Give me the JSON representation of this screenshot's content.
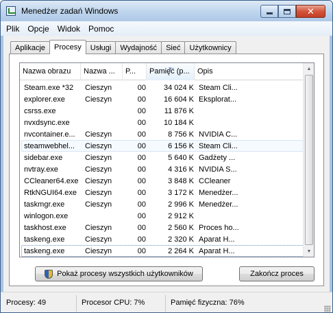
{
  "window": {
    "title": "Menedżer zadań Windows",
    "close_symbol": "✕"
  },
  "menu": [
    "Plik",
    "Opcje",
    "Widok",
    "Pomoc"
  ],
  "tabs": [
    "Aplikacje",
    "Procesy",
    "Usługi",
    "Wydajność",
    "Sieć",
    "Użytkownicy"
  ],
  "active_tab": "Procesy",
  "table": {
    "columns": [
      "Nazwa obrazu",
      "Nazwa ...",
      "P...",
      "Pamięć (p...",
      "Opis"
    ],
    "sorted_column": "Pamięć (p...",
    "rows": [
      [
        "Steam.exe *32",
        "Cieszyn",
        "00",
        "34 024 K",
        "Steam Cli..."
      ],
      [
        "explorer.exe",
        "Cieszyn",
        "00",
        "16 604 K",
        "Eksplorat..."
      ],
      [
        "csrss.exe",
        "",
        "00",
        "11 876 K",
        ""
      ],
      [
        "nvxdsync.exe",
        "",
        "00",
        "10 184 K",
        ""
      ],
      [
        "nvcontainer.e...",
        "Cieszyn",
        "00",
        "8 756 K",
        "NVIDIA C..."
      ],
      [
        "steamwebhel...",
        "Cieszyn",
        "00",
        "6 156 K",
        "Steam Cli..."
      ],
      [
        "sidebar.exe",
        "Cieszyn",
        "00",
        "5 640 K",
        "Gadżety ..."
      ],
      [
        "nvtray.exe",
        "Cieszyn",
        "00",
        "4 316 K",
        "NVIDIA S..."
      ],
      [
        "CCleaner64.exe",
        "Cieszyn",
        "00",
        "3 848 K",
        "CCleaner"
      ],
      [
        "RtkNGUI64.exe",
        "Cieszyn",
        "00",
        "3 172 K",
        "Menedżer..."
      ],
      [
        "taskmgr.exe",
        "Cieszyn",
        "00",
        "2 996 K",
        "Menedżer..."
      ],
      [
        "winlogon.exe",
        "",
        "00",
        "2 912 K",
        ""
      ],
      [
        "taskhost.exe",
        "Cieszyn",
        "00",
        "2 560 K",
        "Proces ho..."
      ],
      [
        "taskeng.exe",
        "Cieszyn",
        "00",
        "2 320 K",
        "Aparat H..."
      ],
      [
        "taskeng.exe",
        "Cieszyn",
        "00",
        "2 264 K",
        "Aparat H..."
      ]
    ]
  },
  "buttons": {
    "show_all": "Pokaż procesy wszystkich użytkowników",
    "end_process": "Zakończ proces"
  },
  "status": {
    "processes": "Procesy: 49",
    "cpu": "Procesor CPU: 7%",
    "memory": "Pamięć fizyczna: 76%"
  }
}
